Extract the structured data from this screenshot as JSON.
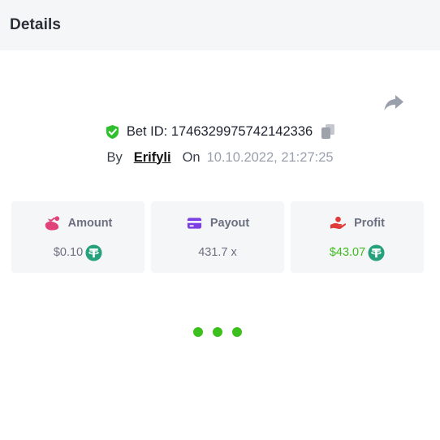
{
  "header": {
    "title": "Details"
  },
  "bet": {
    "id_text": "Bet ID: 1746329975742142336",
    "by_label": "By",
    "username": "Erifyli",
    "on_label": "On",
    "datetime": "10.10.2022, 21:27:25"
  },
  "stats": [
    {
      "label": "Amount",
      "value": "$0.10",
      "icon": "money-bag-icon",
      "currency_icon": "tether-icon"
    },
    {
      "label": "Payout",
      "value": "431.7 x",
      "icon": "credit-card-icon"
    },
    {
      "label": "Profit",
      "value": "$43.07",
      "icon": "hand-money-icon",
      "currency_icon": "tether-icon"
    }
  ],
  "colors": {
    "accent_green": "#3fbb1d",
    "tether_green": "#26a17b",
    "amount_icon": "#e0427a",
    "payout_icon": "#7b3fe4",
    "profit_icon": "#e03a3a",
    "header_bg": "#f5f6f8"
  }
}
